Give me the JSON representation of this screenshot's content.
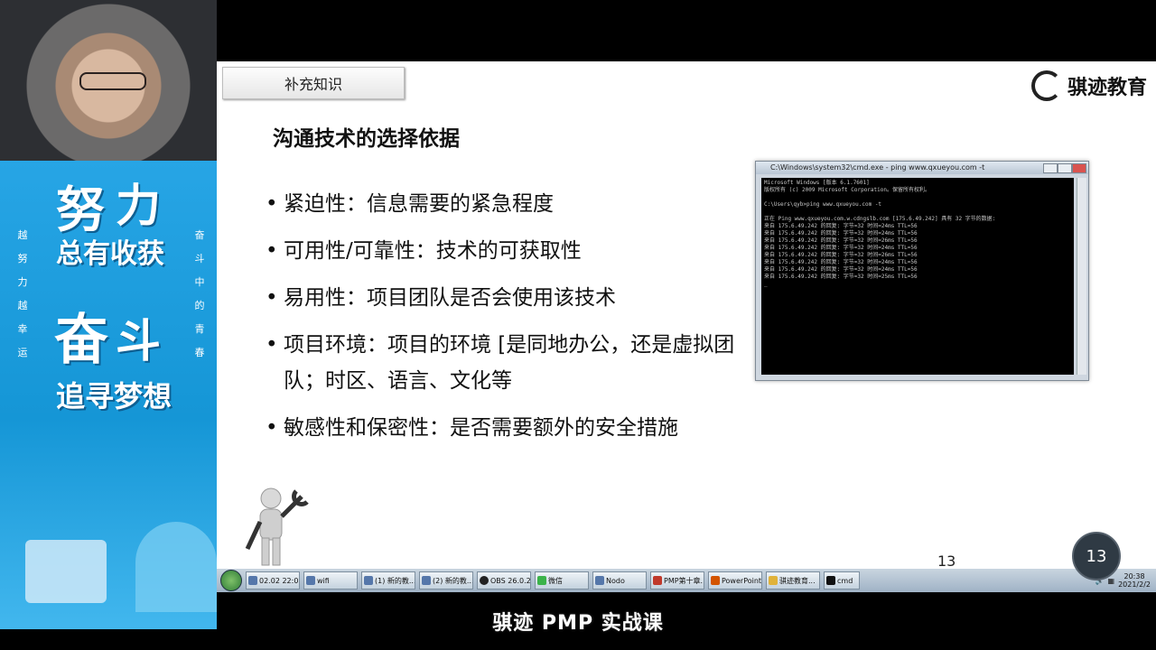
{
  "slide": {
    "section_tab": "补充知识",
    "logo_text": "骐迹教育",
    "title": "沟通技术的选择依据",
    "bullets": [
      "紧迫性：信息需要的紧急程度",
      "可用性/可靠性：技术的可获取性",
      "易用性：项目团队是否会使用该技术",
      "项目环境：项目的环境 [是同地办公，还是虚拟团队；时区、语言、文化等",
      "敏感性和保密性：是否需要额外的安全措施"
    ],
    "page_number": "13"
  },
  "cmd_window": {
    "title": "C:\\Windows\\system32\\cmd.exe - ping www.qxueyou.com -t",
    "lines": [
      "Microsoft Windows [版本 6.1.7601]",
      "版权所有 (c) 2009 Microsoft Corporation。保留所有权利。",
      "",
      "C:\\Users\\qyb>ping www.qxueyou.com -t",
      "",
      "正在 Ping www.qxueyou.com.w.cdngslb.com [175.6.49.242] 具有 32 字节的数据:",
      "来自 175.6.49.242 的回复: 字节=32 时间=24ms TTL=56",
      "来自 175.6.49.242 的回复: 字节=32 时间=24ms TTL=56",
      "来自 175.6.49.242 的回复: 字节=32 时间=26ms TTL=56",
      "来自 175.6.49.242 的回复: 字节=32 时间=24ms TTL=56",
      "来自 175.6.49.242 的回复: 字节=32 时间=26ms TTL=56",
      "来自 175.6.49.242 的回复: 字节=32 时间=24ms TTL=56",
      "来自 175.6.49.242 的回复: 字节=32 时间=24ms TTL=56",
      "来自 175.6.49.242 的回复: 字节=32 时间=25ms TTL=56",
      "_"
    ]
  },
  "poster": {
    "big_chars": [
      "努",
      "力",
      "总有收获",
      "奋",
      "斗",
      "追寻梦想"
    ],
    "vertical_left": "越努力越幸运",
    "vertical_right": "奋斗中的青春"
  },
  "taskbar": {
    "items": [
      {
        "label": "02.02 22:0...",
        "icon": "browser-icon"
      },
      {
        "label": "wifi",
        "icon": "wifi-icon"
      },
      {
        "label": "(1) 新的教...",
        "icon": "chat-icon"
      },
      {
        "label": "(2) 新的教...",
        "icon": "chat-icon"
      },
      {
        "label": "OBS 26.0.2",
        "icon": "obs-icon"
      },
      {
        "label": "微信",
        "icon": "wechat-icon"
      },
      {
        "label": "Nodo",
        "icon": "app-icon"
      },
      {
        "label": "PMP第十章...",
        "icon": "pdf-icon"
      },
      {
        "label": "PowerPoint...",
        "icon": "powerpoint-icon"
      },
      {
        "label": "骐迹教育...",
        "icon": "folder-icon"
      },
      {
        "label": "cmd",
        "icon": "cmd-icon"
      }
    ],
    "clock_time": "20:38",
    "clock_date": "2021/2/2"
  },
  "slide_badge": "13",
  "caption": "骐迹 PMP 实战课"
}
